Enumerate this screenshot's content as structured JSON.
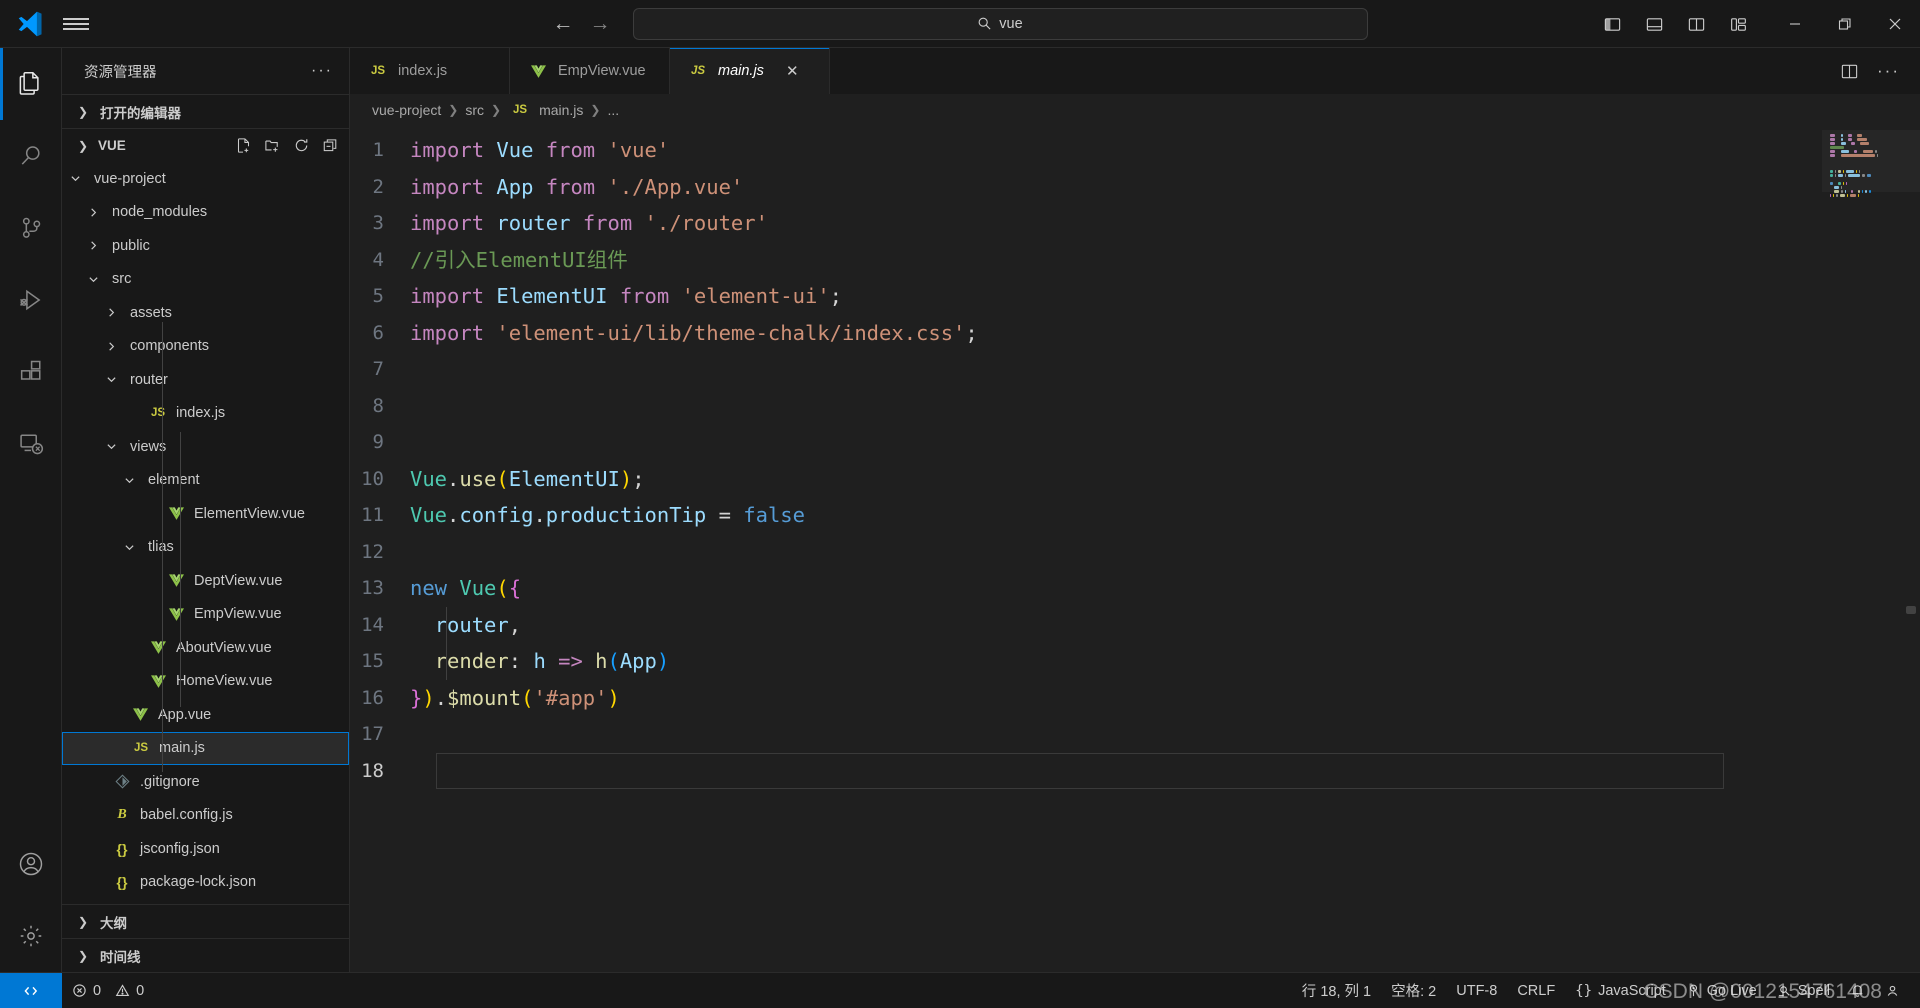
{
  "titlebar": {
    "logo_icon": "vscode-logo-icon",
    "menu_icon": "hamburger-menu-icon",
    "back_icon": "back-arrow-icon",
    "forward_icon": "forward-arrow-icon",
    "search_icon": "search-icon",
    "command_value": "vue",
    "command_placeholder": "vue",
    "layout_buttons": [
      {
        "name": "toggle-primary-sidebar",
        "icon": "layout-sidebar-left-icon"
      },
      {
        "name": "toggle-panel",
        "icon": "layout-panel-icon"
      },
      {
        "name": "toggle-secondary-sidebar",
        "icon": "layout-sidebar-right-icon"
      },
      {
        "name": "customize-layout",
        "icon": "layout-customize-icon"
      }
    ],
    "window_buttons": [
      {
        "name": "minimize-window-button",
        "glyph": "—"
      },
      {
        "name": "restore-window-button",
        "glyph": "❐"
      },
      {
        "name": "close-window-button",
        "glyph": "✕"
      }
    ]
  },
  "activitybar": {
    "items": [
      {
        "label": "Explorer",
        "icon": "files-explorer-icon",
        "active": true
      },
      {
        "label": "Search",
        "icon": "search-icon",
        "active": false
      },
      {
        "label": "Source Control",
        "icon": "source-control-branch-icon",
        "active": false
      },
      {
        "label": "Run and Debug",
        "icon": "run-debug-icon",
        "active": false
      },
      {
        "label": "Extensions",
        "icon": "extensions-blocks-icon",
        "active": false
      },
      {
        "label": "Remote Explorer",
        "icon": "remote-explorer-icon",
        "active": false
      }
    ],
    "bottom": [
      {
        "label": "Accounts",
        "icon": "account-person-icon"
      },
      {
        "label": "Manage",
        "icon": "gear-settings-icon"
      }
    ]
  },
  "sidebar": {
    "title": "资源管理器",
    "more_actions": "···",
    "open_editors_section": "打开的编辑器",
    "workspace_section": "VUE",
    "workspace_actions": [
      {
        "name": "new-file-button",
        "icon": "new-file-icon"
      },
      {
        "name": "new-folder-button",
        "icon": "new-folder-icon"
      },
      {
        "name": "refresh-explorer-button",
        "icon": "refresh-icon"
      },
      {
        "name": "collapse-folders-button",
        "icon": "collapse-all-icon"
      }
    ],
    "outline_section": "大纲",
    "timeline_section": "时间线",
    "tree": [
      {
        "label": "vue-project",
        "depth": 1,
        "type": "folder",
        "state": "open",
        "selected": false
      },
      {
        "label": "node_modules",
        "depth": 2,
        "type": "folder",
        "state": "closed",
        "selected": false
      },
      {
        "label": "public",
        "depth": 2,
        "type": "folder",
        "state": "closed",
        "selected": false
      },
      {
        "label": "src",
        "depth": 2,
        "type": "folder",
        "state": "open",
        "selected": false
      },
      {
        "label": "assets",
        "depth": 3,
        "type": "folder",
        "state": "closed",
        "selected": false
      },
      {
        "label": "components",
        "depth": 3,
        "type": "folder",
        "state": "closed",
        "selected": false
      },
      {
        "label": "router",
        "depth": 3,
        "type": "folder",
        "state": "open",
        "selected": false
      },
      {
        "label": "index.js",
        "depth": 4,
        "type": "js",
        "state": "file",
        "selected": false
      },
      {
        "label": "views",
        "depth": 3,
        "type": "folder",
        "state": "open",
        "selected": false
      },
      {
        "label": "element",
        "depth": 4,
        "type": "folder",
        "state": "open",
        "selected": false
      },
      {
        "label": "ElementView.vue",
        "depth": 5,
        "type": "vue",
        "state": "file",
        "selected": false
      },
      {
        "label": "tlias",
        "depth": 4,
        "type": "folder",
        "state": "open",
        "selected": false
      },
      {
        "label": "DeptView.vue",
        "depth": 5,
        "type": "vue",
        "state": "file",
        "selected": false
      },
      {
        "label": "EmpView.vue",
        "depth": 5,
        "type": "vue",
        "state": "file",
        "selected": false
      },
      {
        "label": "AboutView.vue",
        "depth": 4,
        "type": "vue",
        "state": "file",
        "selected": false
      },
      {
        "label": "HomeView.vue",
        "depth": 4,
        "type": "vue",
        "state": "file",
        "selected": false
      },
      {
        "label": "App.vue",
        "depth": 3,
        "type": "vue",
        "state": "file",
        "selected": false
      },
      {
        "label": "main.js",
        "depth": 3,
        "type": "js",
        "state": "file",
        "selected": true
      },
      {
        "label": ".gitignore",
        "depth": 2,
        "type": "git",
        "state": "file",
        "selected": false
      },
      {
        "label": "babel.config.js",
        "depth": 2,
        "type": "babel",
        "state": "file",
        "selected": false
      },
      {
        "label": "jsconfig.json",
        "depth": 2,
        "type": "json",
        "state": "file",
        "selected": false
      },
      {
        "label": "package-lock.json",
        "depth": 2,
        "type": "json",
        "state": "file",
        "selected": false
      }
    ]
  },
  "editor": {
    "tabs": [
      {
        "label": "index.js",
        "icon": "js-file-icon",
        "active": false,
        "dirty": false
      },
      {
        "label": "EmpView.vue",
        "icon": "vue-file-icon",
        "active": false,
        "dirty": false
      },
      {
        "label": "main.js",
        "icon": "js-file-icon",
        "active": true,
        "dirty": false,
        "close_glyph": "✕"
      }
    ],
    "tab_actions": [
      {
        "name": "split-editor-button",
        "icon": "split-editor-icon"
      },
      {
        "name": "editor-more-actions-button",
        "icon": "ellipsis-icon"
      }
    ],
    "breadcrumb": [
      "vue-project",
      "src",
      "main.js",
      "..."
    ],
    "breadcrumb_separator": "❯",
    "breadcrumb_file_icon": "js-file-icon",
    "cursor_line": 18,
    "lines": [
      {
        "n": 1,
        "tokens": [
          {
            "t": "import",
            "c": "kw"
          },
          {
            "t": " ",
            "c": "op"
          },
          {
            "t": "Vue",
            "c": "id"
          },
          {
            "t": " ",
            "c": "op"
          },
          {
            "t": "from",
            "c": "kw"
          },
          {
            "t": " ",
            "c": "op"
          },
          {
            "t": "'vue'",
            "c": "str"
          }
        ]
      },
      {
        "n": 2,
        "tokens": [
          {
            "t": "import",
            "c": "kw"
          },
          {
            "t": " ",
            "c": "op"
          },
          {
            "t": "App",
            "c": "id"
          },
          {
            "t": " ",
            "c": "op"
          },
          {
            "t": "from",
            "c": "kw"
          },
          {
            "t": " ",
            "c": "op"
          },
          {
            "t": "'./App.vue'",
            "c": "str"
          }
        ]
      },
      {
        "n": 3,
        "tokens": [
          {
            "t": "import",
            "c": "kw"
          },
          {
            "t": " ",
            "c": "op"
          },
          {
            "t": "router",
            "c": "id"
          },
          {
            "t": " ",
            "c": "op"
          },
          {
            "t": "from",
            "c": "kw"
          },
          {
            "t": " ",
            "c": "op"
          },
          {
            "t": "'./router'",
            "c": "str"
          }
        ]
      },
      {
        "n": 4,
        "tokens": [
          {
            "t": "//引入ElementUI组件",
            "c": "com"
          }
        ]
      },
      {
        "n": 5,
        "tokens": [
          {
            "t": "import",
            "c": "kw"
          },
          {
            "t": " ",
            "c": "op"
          },
          {
            "t": "ElementUI",
            "c": "id"
          },
          {
            "t": " ",
            "c": "op"
          },
          {
            "t": "from",
            "c": "kw"
          },
          {
            "t": " ",
            "c": "op"
          },
          {
            "t": "'element-ui'",
            "c": "str"
          },
          {
            "t": ";",
            "c": "op"
          }
        ]
      },
      {
        "n": 6,
        "tokens": [
          {
            "t": "import",
            "c": "kw"
          },
          {
            "t": " ",
            "c": "op"
          },
          {
            "t": "'element-ui/lib/theme-chalk/index.css'",
            "c": "str"
          },
          {
            "t": ";",
            "c": "op"
          }
        ]
      },
      {
        "n": 7,
        "tokens": []
      },
      {
        "n": 8,
        "tokens": []
      },
      {
        "n": 9,
        "tokens": []
      },
      {
        "n": 10,
        "tokens": [
          {
            "t": "Vue",
            "c": "cls"
          },
          {
            "t": ".",
            "c": "op"
          },
          {
            "t": "use",
            "c": "fn"
          },
          {
            "t": "(",
            "c": "p1"
          },
          {
            "t": "ElementUI",
            "c": "id"
          },
          {
            "t": ")",
            "c": "p1"
          },
          {
            "t": ";",
            "c": "op"
          }
        ]
      },
      {
        "n": 11,
        "tokens": [
          {
            "t": "Vue",
            "c": "cls"
          },
          {
            "t": ".",
            "c": "op"
          },
          {
            "t": "config",
            "c": "id"
          },
          {
            "t": ".",
            "c": "op"
          },
          {
            "t": "productionTip",
            "c": "id"
          },
          {
            "t": " = ",
            "c": "op"
          },
          {
            "t": "false",
            "c": "kw2"
          }
        ]
      },
      {
        "n": 12,
        "tokens": []
      },
      {
        "n": 13,
        "tokens": [
          {
            "t": "new",
            "c": "kw2"
          },
          {
            "t": " ",
            "c": "op"
          },
          {
            "t": "Vue",
            "c": "cls"
          },
          {
            "t": "(",
            "c": "p1"
          },
          {
            "t": "{",
            "c": "p2"
          }
        ]
      },
      {
        "n": 14,
        "tokens": [
          {
            "t": "  ",
            "c": "op"
          },
          {
            "t": "router",
            "c": "id"
          },
          {
            "t": ",",
            "c": "op"
          }
        ]
      },
      {
        "n": 15,
        "tokens": [
          {
            "t": "  ",
            "c": "op"
          },
          {
            "t": "render",
            "c": "fn"
          },
          {
            "t": ": ",
            "c": "op"
          },
          {
            "t": "h",
            "c": "id"
          },
          {
            "t": " ",
            "c": "op"
          },
          {
            "t": "=>",
            "c": "kw"
          },
          {
            "t": " ",
            "c": "op"
          },
          {
            "t": "h",
            "c": "fn"
          },
          {
            "t": "(",
            "c": "p3"
          },
          {
            "t": "App",
            "c": "id"
          },
          {
            "t": ")",
            "c": "p3"
          }
        ]
      },
      {
        "n": 16,
        "tokens": [
          {
            "t": "}",
            "c": "p2"
          },
          {
            "t": ")",
            "c": "p1"
          },
          {
            "t": ".",
            "c": "op"
          },
          {
            "t": "$mount",
            "c": "fn"
          },
          {
            "t": "(",
            "c": "p1"
          },
          {
            "t": "'#app'",
            "c": "str"
          },
          {
            "t": ")",
            "c": "p1"
          }
        ]
      },
      {
        "n": 17,
        "tokens": []
      },
      {
        "n": 18,
        "tokens": []
      }
    ]
  },
  "statusbar": {
    "remote_icon": "remote-window-icon",
    "problems": {
      "error_icon": "error-circle-icon",
      "errors": "0",
      "warning_icon": "warning-triangle-icon",
      "warnings": "0"
    },
    "cursor_position": "行 18, 列 1",
    "indentation": "空格: 2",
    "encoding": "UTF-8",
    "eol": "CRLF",
    "language_icon": "braces-icon",
    "language": "JavaScript",
    "golive_icon": "broadcast-icon",
    "golive": "Go Live",
    "spell_icon": "spell-check-icon",
    "spell": "Spell",
    "bell_icon": "bell-icon",
    "account_icon": "account-person-icon",
    "watermark": "CSDN @0012154761408"
  },
  "colors": {
    "accent": "#0078d4",
    "titlebar_bg": "#181818",
    "editor_bg": "#1f1f1f",
    "sidebar_bg": "#181818",
    "selected_row_bg": "#2b2b2b",
    "token_keyword": "#c586c0",
    "token_string": "#ce9178",
    "token_comment": "#6a9955",
    "token_identifier": "#9cdcfe",
    "token_class": "#4ec9b0",
    "token_function": "#dcdcaa",
    "token_control": "#569cd6"
  }
}
